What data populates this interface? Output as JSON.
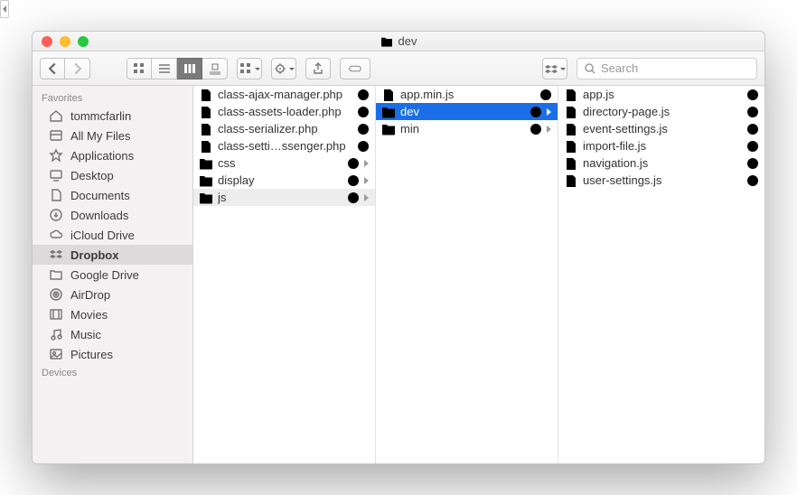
{
  "window": {
    "title": "dev"
  },
  "toolbar": {
    "search_placeholder": "Search"
  },
  "sidebar": {
    "sections": [
      {
        "header": "Favorites",
        "items": [
          {
            "icon": "home",
            "label": "tommcfarlin"
          },
          {
            "icon": "allfiles",
            "label": "All My Files"
          },
          {
            "icon": "apps",
            "label": "Applications"
          },
          {
            "icon": "desktop",
            "label": "Desktop"
          },
          {
            "icon": "documents",
            "label": "Documents"
          },
          {
            "icon": "downloads",
            "label": "Downloads"
          },
          {
            "icon": "cloud",
            "label": "iCloud Drive"
          },
          {
            "icon": "dropbox",
            "label": "Dropbox",
            "selected": true
          },
          {
            "icon": "folder",
            "label": "Google Drive"
          },
          {
            "icon": "airdrop",
            "label": "AirDrop"
          },
          {
            "icon": "movies",
            "label": "Movies"
          },
          {
            "icon": "music",
            "label": "Music"
          },
          {
            "icon": "pictures",
            "label": "Pictures"
          }
        ]
      },
      {
        "header": "Devices",
        "items": []
      }
    ]
  },
  "columns": [
    {
      "items": [
        {
          "type": "php",
          "name": "class-ajax-manager.php",
          "synced": true
        },
        {
          "type": "php",
          "name": "class-assets-loader.php",
          "synced": true
        },
        {
          "type": "php",
          "name": "class-serializer.php",
          "synced": true
        },
        {
          "type": "php",
          "name": "class-setti…ssenger.php",
          "synced": true
        },
        {
          "type": "folder",
          "name": "css",
          "synced": true,
          "expandable": true
        },
        {
          "type": "folder",
          "name": "display",
          "synced": true,
          "expandable": true
        },
        {
          "type": "folder",
          "name": "js",
          "synced": true,
          "expandable": true,
          "sel": "grey"
        }
      ]
    },
    {
      "items": [
        {
          "type": "js",
          "name": "app.min.js",
          "synced": true
        },
        {
          "type": "folder",
          "name": "dev",
          "synced": true,
          "expandable": true,
          "sel": "blue"
        },
        {
          "type": "folder",
          "name": "min",
          "synced": true,
          "expandable": true
        }
      ]
    },
    {
      "items": [
        {
          "type": "js",
          "name": "app.js",
          "synced": true
        },
        {
          "type": "js",
          "name": "directory-page.js",
          "synced": true
        },
        {
          "type": "js",
          "name": "event-settings.js",
          "synced": true
        },
        {
          "type": "js",
          "name": "import-file.js",
          "synced": true
        },
        {
          "type": "js",
          "name": "navigation.js",
          "synced": true
        },
        {
          "type": "js",
          "name": "user-settings.js",
          "synced": true
        }
      ]
    }
  ]
}
